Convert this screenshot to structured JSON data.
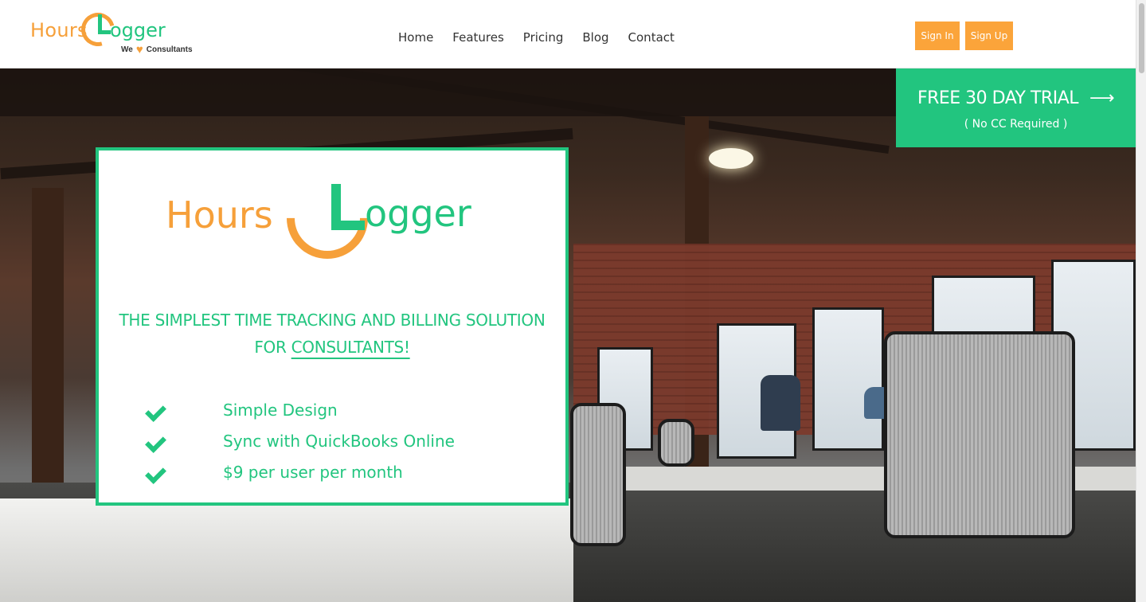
{
  "brand": {
    "name_part1": "Hours",
    "name_part2": "ogger",
    "tagline_left": "We",
    "tagline_right": "Consultants"
  },
  "nav": {
    "items": [
      {
        "label": "Home"
      },
      {
        "label": "Features"
      },
      {
        "label": "Pricing"
      },
      {
        "label": "Blog"
      },
      {
        "label": "Contact"
      }
    ]
  },
  "auth": {
    "signin_label": "Sign In",
    "signup_label": "Sign Up"
  },
  "trial": {
    "title": "FREE 30 DAY TRIAL",
    "arrow": "⟶",
    "subtitle": "( No CC Required )"
  },
  "card": {
    "logo_part1": "Hours",
    "logo_part2": "ogger",
    "headline_line1": "THE SIMPLEST TIME TRACKING AND BILLING SOLUTION",
    "headline_prefix": "FOR ",
    "headline_emphasis": "CONSULTANTS!",
    "features": [
      {
        "text": "Simple Design"
      },
      {
        "text": "Sync with QuickBooks Online"
      },
      {
        "text": "$9 per user per month"
      }
    ]
  },
  "colors": {
    "brand_green": "#22c57f",
    "brand_orange": "#f6a03a",
    "button_orange": "#fba43a"
  }
}
